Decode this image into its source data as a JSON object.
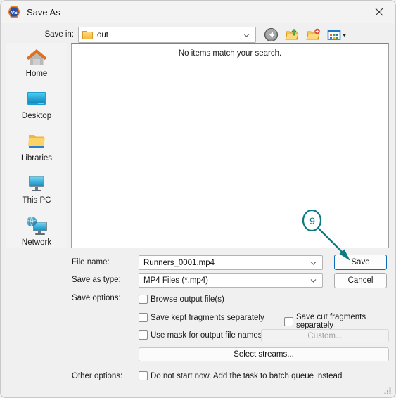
{
  "window": {
    "title": "Save As",
    "app_icon": "vs-badge-icon",
    "app_icon_text": "VS",
    "close_icon": "close-icon"
  },
  "savein": {
    "label": "Save in:",
    "value": "out",
    "folder_icon": "folder-icon",
    "dropdown_icon": "chevron-down-icon"
  },
  "toolbar": {
    "items": [
      {
        "name": "back-button",
        "icon": "back-arrow-icon",
        "label": "Back"
      },
      {
        "name": "up-one-level-button",
        "icon": "up-folder-icon",
        "label": "Up One Level"
      },
      {
        "name": "create-new-folder-button",
        "icon": "new-folder-icon",
        "label": "Create New Folder"
      },
      {
        "name": "views-button",
        "icon": "views-grid-icon",
        "label": "Views"
      }
    ]
  },
  "places": {
    "items": [
      {
        "label": "Home",
        "icon": "home-icon"
      },
      {
        "label": "Desktop",
        "icon": "desktop-monitor-icon"
      },
      {
        "label": "Libraries",
        "icon": "libraries-folder-icon"
      },
      {
        "label": "This PC",
        "icon": "this-pc-monitor-icon"
      },
      {
        "label": "Network",
        "icon": "network-globe-icon"
      }
    ]
  },
  "filelist": {
    "empty_message": "No items match your search."
  },
  "form": {
    "filename_label": "File name:",
    "filename_value": "Runners_0001.mp4",
    "filetype_label": "Save as type:",
    "filetype_value": "MP4 Files (*.mp4)",
    "save_button": "Save",
    "cancel_button": "Cancel"
  },
  "save_options": {
    "label": "Save options:",
    "browse_output": "Browse output file(s)",
    "save_kept": "Save kept fragments separately",
    "save_cut": "Save cut fragments separately",
    "use_mask": "Use mask for output file names",
    "custom_button": "Custom...",
    "select_streams_button": "Select streams..."
  },
  "other_options": {
    "label": "Other options:",
    "batch_queue": "Do not start now. Add the task to batch queue instead"
  },
  "annotation": {
    "step_number": "9",
    "color": "#0d7a80",
    "target": "Save"
  },
  "colors": {
    "accent_blue": "#0c6bbd",
    "dialog_bg": "#f0f0f0",
    "panel_bg": "#ffffff",
    "teal": "#0d7a80"
  }
}
